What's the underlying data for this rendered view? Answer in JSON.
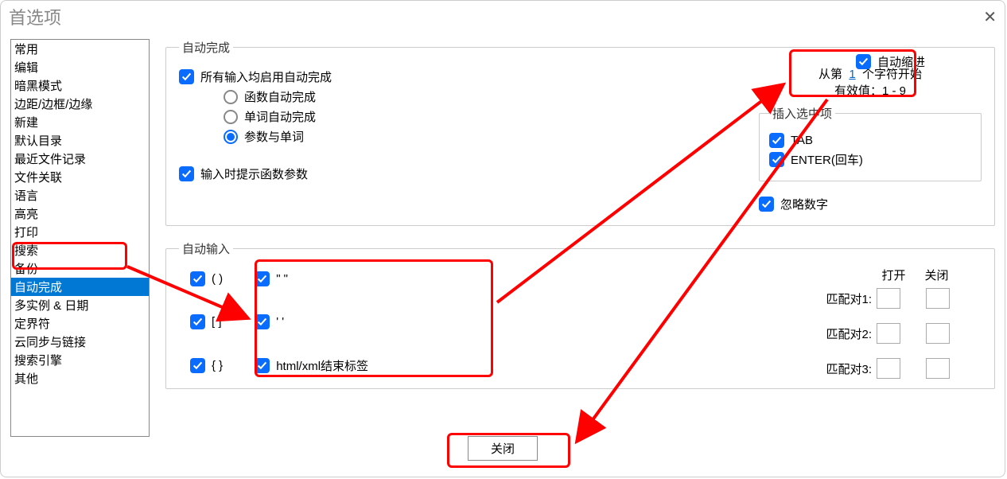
{
  "window_title": "首选项",
  "sidebar": {
    "items": [
      "常用",
      "编辑",
      "暗黑模式",
      "边距/边框/边缘",
      "新建",
      "默认目录",
      "最近文件记录",
      "文件关联",
      "语言",
      "高亮",
      "打印",
      "搜索",
      "备份",
      "自动完成",
      "多实例 & 日期",
      "定界符",
      "云同步与链接",
      "搜索引擎",
      "其他"
    ],
    "selected_index": 13
  },
  "groups": {
    "auto_complete_legend": "自动完成",
    "auto_input_legend": "自动输入"
  },
  "checkboxes": {
    "enable_all": "所有输入均启用自动完成",
    "show_param": "输入时提示函数参数",
    "ignore_digit": "忽略数字",
    "auto_indent": "自动缩进",
    "tab": "TAB",
    "enter": "ENTER(回车)",
    "paren": "(  )",
    "bracket": "[  ]",
    "brace": "{  }",
    "dquote": "\"  \"",
    "squote": "'  '",
    "htmlxml": "html/xml结束标签"
  },
  "radios": {
    "func": "函数自动完成",
    "word": "单词自动完成",
    "param_word": "参数与单词"
  },
  "start_char": {
    "prefix": "从第",
    "value": "1",
    "suffix": "个字符开始",
    "valid": "有效值：1 - 9"
  },
  "insert_legend": "插入选中项",
  "pairs": {
    "open_label": "打开",
    "close_label": "关闭",
    "row1": "匹配对1:",
    "row2": "匹配对2:",
    "row3": "匹配对3:"
  },
  "close_button": "关闭"
}
